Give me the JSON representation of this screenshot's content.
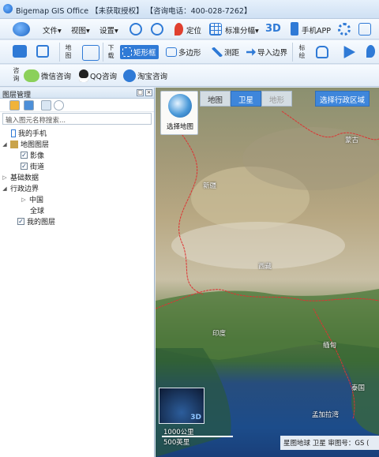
{
  "window": {
    "title": "Bigemap GIS Office 【未获取授权】   【咨询电话：400-028-7262】"
  },
  "ribbon1": {
    "menu_file": "文件▾",
    "menu_view": "视图▾",
    "menu_settings": "设置▾",
    "locate": "定位",
    "standard_tiles": "标准分幅▾",
    "threed": "3D",
    "mobile_app": "手机APP"
  },
  "ribbon2": {
    "group_map": "地图",
    "group_download": "下载",
    "rectangle": "矩形框",
    "polygon": "多边形",
    "survey": "测距",
    "import_boundary": "导入边界",
    "group_mark": "标绘"
  },
  "ribbon3": {
    "group_consult": "咨询",
    "wechat": "微信咨询",
    "qq": "QQ咨询",
    "taobao": "淘宝咨询"
  },
  "panel": {
    "title": "图层管理",
    "search_placeholder": "输入图元名称搜索...",
    "tree": [
      {
        "label": "我的手机"
      },
      {
        "label": "地图图层"
      },
      {
        "label": "影像"
      },
      {
        "label": "街道"
      },
      {
        "label": "基础数据"
      },
      {
        "label": "行政边界"
      },
      {
        "label": "中国"
      },
      {
        "label": "全球"
      },
      {
        "label": "我的图层"
      }
    ]
  },
  "map": {
    "tabs": [
      "地图",
      "卫星",
      "地形"
    ],
    "active_tab": "卫星",
    "select_region": "选择行政区域",
    "select_map": "选择地图",
    "labels": [
      "蒙古",
      "印度",
      "缅甸",
      "泰国",
      "孟加拉湾",
      "新疆",
      "西藏"
    ],
    "scale_km": "1000公里",
    "scale_mi": "500英里",
    "minimap_3d": "3D",
    "status": "星图地球 卫星  审图号：GS ("
  }
}
